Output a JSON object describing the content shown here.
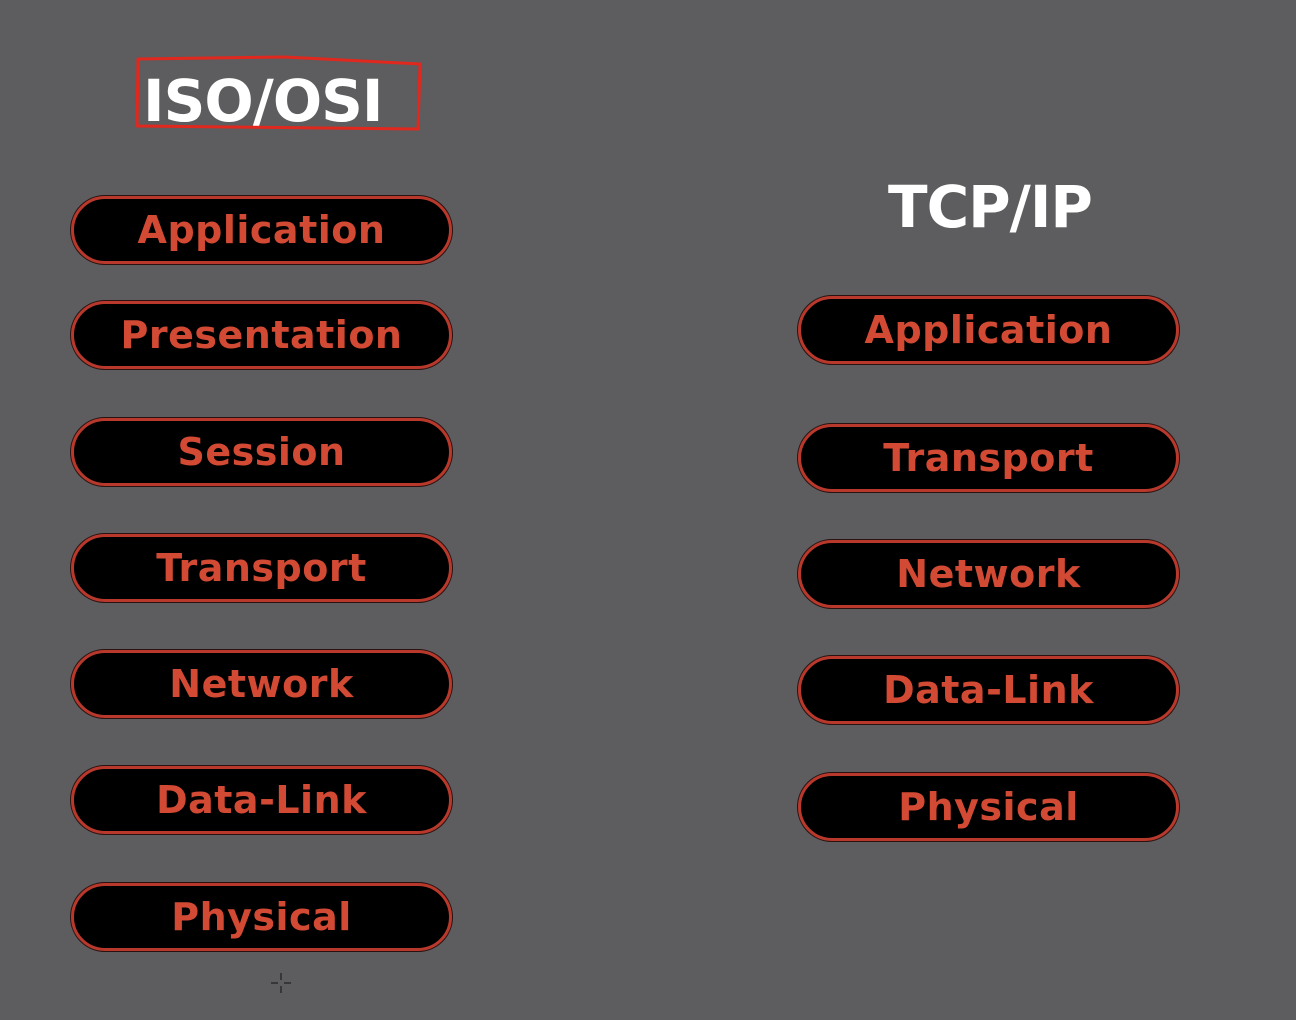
{
  "osi": {
    "title": "ISO/OSI",
    "layers": [
      "Application",
      "Presentation",
      "Session",
      "Transport",
      "Network",
      "Data-Link",
      "Physical"
    ]
  },
  "tcpip": {
    "title": "TCP/IP",
    "layers": [
      "Application",
      "Transport",
      "Network",
      "Data-Link",
      "Physical"
    ]
  },
  "colors": {
    "background": "#5d5c5e",
    "pill_fill": "#000000",
    "pill_border": "#b8392c",
    "pill_text": "#d34a34",
    "title_text": "#ffffff",
    "highlight_stroke": "#e0281e"
  },
  "icons": {
    "cursor": "crosshair-cursor-icon"
  }
}
